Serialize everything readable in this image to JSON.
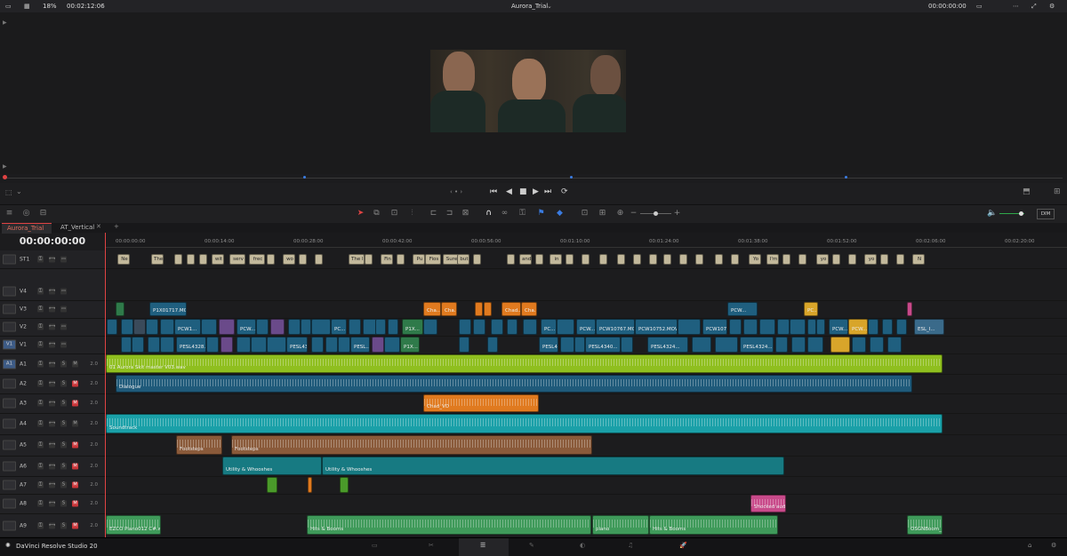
{
  "topbar": {
    "zoom": "18%",
    "timecode_left": "00:02:12:06",
    "timeline_name": "Aurora_Trial",
    "timecode_right": "00:00:00:00"
  },
  "tabs": [
    "Aurora_Trial",
    "AT_Vertical"
  ],
  "timeline": {
    "current_timecode": "00:00:00:00",
    "ruler_ticks": [
      "00:00:00:00",
      "00:00:14:00",
      "00:00:28:00",
      "00:00:42:00",
      "00:00:56:00",
      "00:01:10:00",
      "00:01:24:00",
      "00:01:38:00",
      "00:01:52:00",
      "00:02:06:00",
      "00:02:20:00"
    ]
  },
  "tracks": [
    {
      "code": "ST1",
      "name": "ST1",
      "type": "subtitle"
    },
    {
      "code": "V4",
      "name": "V4",
      "type": "video"
    },
    {
      "code": "V3",
      "name": "V3",
      "type": "video"
    },
    {
      "code": "V2",
      "name": "V2",
      "type": "video"
    },
    {
      "code": "V1",
      "name": "V1",
      "type": "video"
    },
    {
      "code": "A1",
      "name": "A1",
      "type": "audio",
      "vol": "2.0"
    },
    {
      "code": "A2",
      "name": "A2",
      "type": "audio",
      "vol": "2.0"
    },
    {
      "code": "A3",
      "name": "A3",
      "type": "audio",
      "vol": "2.0"
    },
    {
      "code": "A4",
      "name": "A4",
      "type": "audio",
      "vol": "2.0"
    },
    {
      "code": "A5",
      "name": "A5",
      "type": "audio",
      "vol": "2.0"
    },
    {
      "code": "A6",
      "name": "A6",
      "type": "audio",
      "vol": "2.0"
    },
    {
      "code": "A7",
      "name": "A7",
      "type": "audio",
      "vol": "2.0"
    },
    {
      "code": "A8",
      "name": "A8",
      "type": "audio",
      "vol": "2.0"
    },
    {
      "code": "A9",
      "name": "A9",
      "type": "audio",
      "vol": "2.0"
    }
  ],
  "subtitles": [
    "Ne",
    "The",
    "",
    "",
    "",
    "wit",
    "serv",
    "frec",
    "",
    "wo",
    "",
    "",
    "The li",
    "",
    "Fin",
    "",
    "Pu",
    "Fios",
    "Sure",
    "but",
    "",
    "",
    "and",
    "",
    "in",
    "",
    "",
    "",
    "",
    "",
    "",
    "",
    "",
    "",
    "",
    "",
    "Yo",
    "I'm",
    "",
    "",
    "yo",
    "",
    "",
    "yo",
    "",
    "",
    "N"
  ],
  "clips": {
    "v3": [
      "P1X01717.MOV",
      "Cha...",
      "Cha...",
      "Chad...",
      "Cha...",
      "PCW...",
      "PC..."
    ],
    "v2": [
      "PCW1...",
      "PCW...",
      "PC...",
      "P1X...",
      "PC...",
      "PCW...",
      "PCW10767.MOV",
      "PCW10752.MOV",
      "PCW107...",
      "PCW...",
      "PCW...",
      "ESL_I..."
    ],
    "v1": [
      "PESL4328...",
      "PESL4327...",
      "PESL...",
      "P1X...",
      "PESL4...",
      "PESL4340...",
      "PESL4324...",
      "PESL4324..."
    ],
    "a1": "01 Aurora Skit master V03.wav",
    "a2": "Dialogue",
    "a3": "Chad_VO",
    "a4": "Soundtrack",
    "a5": [
      "Footsteps",
      "Footsteps"
    ],
    "a6": [
      "Utility & Whooshes",
      "Utility & Whooshes"
    ],
    "a8": "Shocked audi...",
    "a9": [
      "EZCO Piano012 C#.wav",
      "Hits & Booms",
      "piano",
      "Hits & Booms",
      "OSGNBoom_..."
    ]
  },
  "bottombar": {
    "app_name": "DaVinci Resolve Studio 20"
  },
  "colors": {
    "video": "#1f5f7f",
    "video_alt": "#6a4a8a",
    "orange": "#e07a1f",
    "lime": "#8fbf1f",
    "blue": "#1f5a7a",
    "teal": "#1aa0a8",
    "brown": "#8a5a3a",
    "green": "#3f9a5a",
    "pink": "#c84a8a"
  }
}
